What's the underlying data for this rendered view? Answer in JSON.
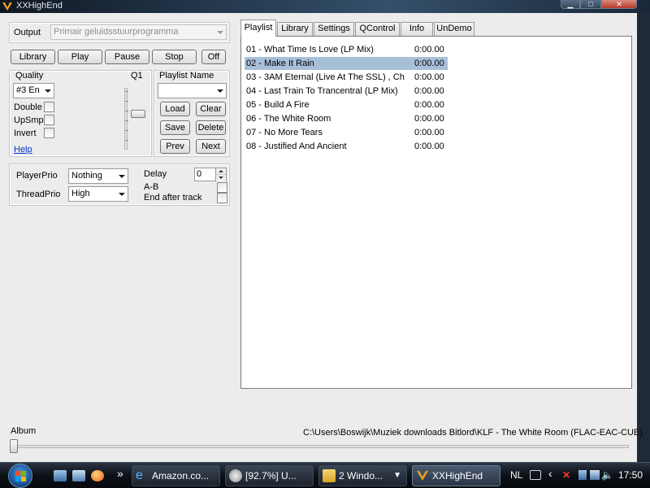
{
  "window": {
    "title": "XXHighEnd"
  },
  "output": {
    "label": "Output",
    "device": "Primair geluidsstuurprogramma"
  },
  "transport": {
    "library": "Library",
    "play": "Play",
    "pause": "Pause",
    "stop": "Stop",
    "off": "Off"
  },
  "quality": {
    "label": "Quality",
    "q_label": "Q1",
    "engine": "#3 En",
    "double": "Double",
    "upsmp": "UpSmp",
    "invert": "Invert",
    "help": "Help"
  },
  "playlist_name": {
    "label": "Playlist Name",
    "value": "",
    "load": "Load",
    "clear": "Clear",
    "save": "Save",
    "delete": "Delete",
    "prev": "Prev",
    "next": "Next"
  },
  "prio": {
    "player_label": "PlayerPrio",
    "player_value": "Nothing",
    "thread_label": "ThreadPrio",
    "thread_value": "High",
    "delay_label": "Delay",
    "delay_value": "0",
    "ab_label": "A-B",
    "end_label": "End after track"
  },
  "tabs": [
    "Playlist",
    "Library",
    "Settings",
    "QControl",
    "Info",
    "UnDemo"
  ],
  "tracks": [
    {
      "title": "01 - What Time Is Love  (LP Mix)",
      "duration": "0:00.00"
    },
    {
      "title": "02 - Make It Rain",
      "duration": "0:00.00",
      "selected": true
    },
    {
      "title": "03 - 3AM Eternal (Live At The SSL) , Ch",
      "duration": "0:00.00"
    },
    {
      "title": "04 - Last Train To Trancentral (LP Mix)",
      "duration": "0:00.00"
    },
    {
      "title": "05 - Build A Fire",
      "duration": "0:00.00"
    },
    {
      "title": "06 - The White Room",
      "duration": "0:00.00"
    },
    {
      "title": "07 - No More Tears",
      "duration": "0:00.00"
    },
    {
      "title": "08 - Justified And Ancient",
      "duration": "0:00.00"
    }
  ],
  "status": {
    "album_label": "Album",
    "path": "C:\\Users\\Boswijk\\Muziek downloads Bitlord\\KLF - The White Room (FLAC-EAC-CUE)"
  },
  "taskbar": {
    "items": [
      {
        "label": "Amazon.co...",
        "icon": "ie-icon"
      },
      {
        "label": "[92.7%]   U...",
        "icon": "eac-icon"
      },
      {
        "label": "2 Windo...",
        "icon": "folder-icon"
      },
      {
        "label": "XXHighEnd",
        "icon": "xxhighend-icon",
        "active": true
      }
    ],
    "more": "»",
    "language": "NL",
    "clock": "17:50"
  },
  "colors": {
    "selection": "#a8bfd8",
    "link": "#0033cc",
    "taskbar": "#0d1117"
  }
}
